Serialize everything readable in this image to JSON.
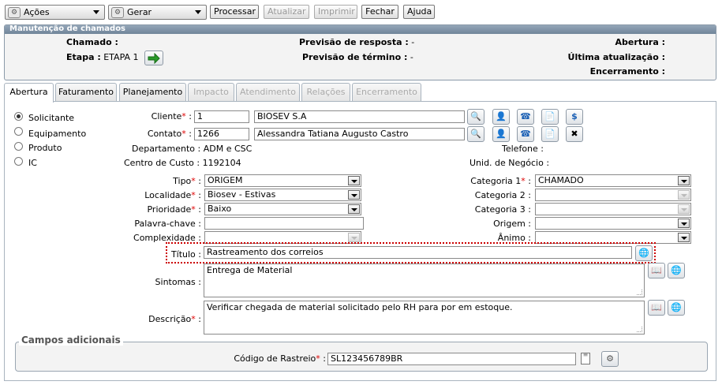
{
  "toolbar": {
    "acoes": "Ações",
    "gerar": "Gerar",
    "processar": "Processar",
    "atualizar": "Atualizar",
    "imprimir": "Imprimir",
    "fechar": "Fechar",
    "ajuda": "Ajuda"
  },
  "header": {
    "title": "Manutenção de chamados",
    "chamado_label": "Chamado :",
    "chamado_value": "",
    "etapa_label": "Etapa :",
    "etapa_value": "ETAPA 1",
    "prev_resposta_label": "Previsão de resposta :",
    "prev_resposta_value": "-",
    "prev_termino_label": "Previsão de término :",
    "prev_termino_value": "-",
    "abertura_label": "Abertura :",
    "ultima_label": "Última atualização :",
    "encerramento_label": "Encerramento :"
  },
  "tabs": [
    {
      "label": "Abertura",
      "enabled": true,
      "active": true
    },
    {
      "label": "Faturamento",
      "enabled": true
    },
    {
      "label": "Planejamento",
      "enabled": true
    },
    {
      "label": "Impacto",
      "enabled": false
    },
    {
      "label": "Atendimento",
      "enabled": false
    },
    {
      "label": "Relações",
      "enabled": false
    },
    {
      "label": "Encerramento",
      "enabled": false
    }
  ],
  "radios": [
    {
      "label": "Solicitante",
      "checked": true
    },
    {
      "label": "Equipamento",
      "checked": false
    },
    {
      "label": "Produto",
      "checked": false
    },
    {
      "label": "IC",
      "checked": false
    }
  ],
  "form": {
    "cliente_label": "Cliente",
    "cliente_code": "1",
    "cliente_name": "BIOSEV S.A",
    "contato_label": "Contato",
    "contato_code": "1266",
    "contato_name": "Alessandra Tatiana Augusto Castro",
    "departamento": "Departamento : ADM e CSC",
    "telefone": "Telefone :",
    "centro_custo": "Centro de Custo : 1192104",
    "unid_negocio": "Unid. de Negócio :",
    "tipo_label": "Tipo",
    "tipo_value": "ORIGEM",
    "localidade_label": "Localidade",
    "localidade_value": "Biosev - Estivas",
    "prioridade_label": "Prioridade",
    "prioridade_value": "Baixo",
    "palavra_label": "Palavra-chave :",
    "palavra_value": "",
    "complexidade_label": "Complexidade :",
    "categoria1_label": "Categoria 1",
    "categoria1_value": "CHAMADO",
    "categoria2_label": "Categoria 2 :",
    "categoria3_label": "Categoria 3 :",
    "origem_label": "Origem :",
    "animo_label": "Ânimo :",
    "titulo_label": "Título :",
    "titulo_value": "Rastreamento dos correios",
    "sintomas_label": "Sintomas :",
    "sintomas_value": "Entrega de Material",
    "descricao_label": "Descrição",
    "descricao_value": "Verificar chegada de material solicitado pelo RH para por em estoque."
  },
  "adicionais": {
    "legend": "Campos adicionais",
    "rastreio_label": "Código de Rastreio",
    "rastreio_value": "SL123456789BR"
  },
  "colors": {
    "header": "#7d90a4",
    "required": "#dd0000",
    "highlight_border": "#cc0000"
  }
}
